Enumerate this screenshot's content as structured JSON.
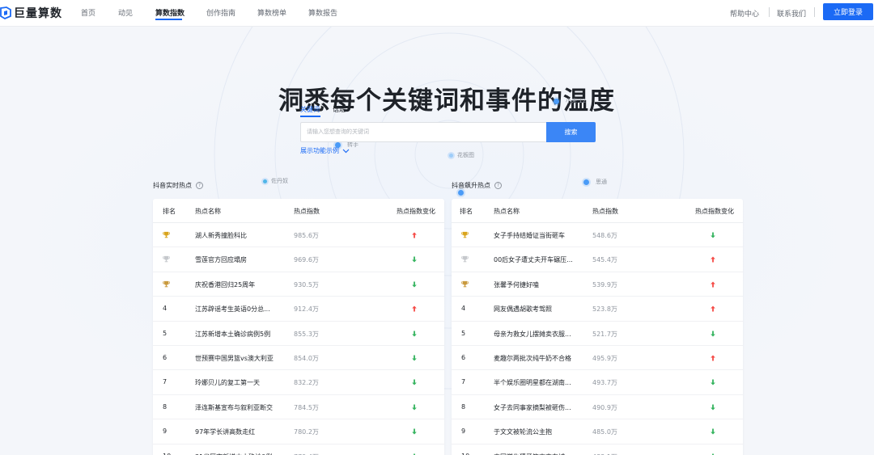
{
  "header": {
    "logo_text": "巨量算数",
    "nav": [
      "首页",
      "动见",
      "算数指数",
      "创作指南",
      "算数榜单",
      "算数报告"
    ],
    "active_nav": "算数指数",
    "help": "帮助中心",
    "contact": "联系我们",
    "login": "立即登录"
  },
  "hero": {
    "title": "洞悉每个关键词和事件的温度",
    "bubbles": [
      "小米 12",
      "转手",
      "花板图",
      "佐丹奴",
      "思通"
    ]
  },
  "search": {
    "tabs": [
      "关键词",
      "话题"
    ],
    "active_tab": "关键词",
    "placeholder": "请输入您想查询的关键词",
    "button": "搜索",
    "demo_link": "展示功能示例"
  },
  "columns": {
    "rank": "排名",
    "name": "热点名称",
    "index": "热点指数",
    "change": "热点指数变化"
  },
  "realtime": {
    "title": "抖音实时热点",
    "rows": [
      {
        "rank": "",
        "medal": "gold",
        "name": "湖人新秀撞脸科比",
        "value": "985.6万",
        "trend": "up"
      },
      {
        "rank": "",
        "medal": "silver",
        "name": "雪莲官方回应塌房",
        "value": "969.6万",
        "trend": "down"
      },
      {
        "rank": "",
        "medal": "bronze",
        "name": "庆祝香港回归25周年",
        "value": "930.5万",
        "trend": "down"
      },
      {
        "rank": "4",
        "medal": "",
        "name": "江苏辟谣考生英语0分总...",
        "value": "912.4万",
        "trend": "up"
      },
      {
        "rank": "5",
        "medal": "",
        "name": "江苏新增本土确诊病例5例",
        "value": "855.3万",
        "trend": "down"
      },
      {
        "rank": "6",
        "medal": "",
        "name": "世预赛中国男篮vs澳大利亚",
        "value": "854.0万",
        "trend": "down"
      },
      {
        "rank": "7",
        "medal": "",
        "name": "玲娜贝儿的复工第一天",
        "value": "832.2万",
        "trend": "down"
      },
      {
        "rank": "8",
        "medal": "",
        "name": "泽连斯基宣布与叙利亚断交",
        "value": "784.5万",
        "trend": "down"
      },
      {
        "rank": "9",
        "medal": "",
        "name": "97年学长讲高数走红",
        "value": "780.2万",
        "trend": "down"
      },
      {
        "rank": "10",
        "medal": "",
        "name": "31省区市新增本土确诊0例",
        "value": "779.4万",
        "trend": "down"
      }
    ]
  },
  "rising": {
    "title": "抖音飙升热点",
    "rows": [
      {
        "rank": "",
        "medal": "gold",
        "name": "女子手持结婚证当街砸车",
        "value": "548.6万",
        "trend": "down"
      },
      {
        "rank": "",
        "medal": "silver",
        "name": "00后女子遭丈夫开车碾压...",
        "value": "545.4万",
        "trend": "up"
      },
      {
        "rank": "",
        "medal": "bronze",
        "name": "张馨予何捷好嗑",
        "value": "539.9万",
        "trend": "up"
      },
      {
        "rank": "4",
        "medal": "",
        "name": "网友偶遇胡歌考驾照",
        "value": "523.8万",
        "trend": "up"
      },
      {
        "rank": "5",
        "medal": "",
        "name": "母亲为救女儿摆摊卖衣服...",
        "value": "521.7万",
        "trend": "down"
      },
      {
        "rank": "6",
        "medal": "",
        "name": "麦趣尔两批次纯牛奶不合格",
        "value": "495.9万",
        "trend": "up"
      },
      {
        "rank": "7",
        "medal": "",
        "name": "半个娱乐圈明星都在湖南...",
        "value": "493.7万",
        "trend": "down"
      },
      {
        "rank": "8",
        "medal": "",
        "name": "女子去同事家摘梨被砸伤...",
        "value": "490.9万",
        "trend": "down"
      },
      {
        "rank": "9",
        "medal": "",
        "name": "于文文被轮流公主抱",
        "value": "485.0万",
        "trend": "down"
      },
      {
        "rank": "10",
        "medal": "",
        "name": "中国学生猜牙签事变东城",
        "value": "483.1万",
        "trend": "down"
      }
    ]
  },
  "colors": {
    "primary": "#1b6af5",
    "up": "#f54a45",
    "down": "#34b35e",
    "gold": "#d9a41c",
    "silver": "#c5c8cc",
    "bronze": "#c99a3e"
  }
}
